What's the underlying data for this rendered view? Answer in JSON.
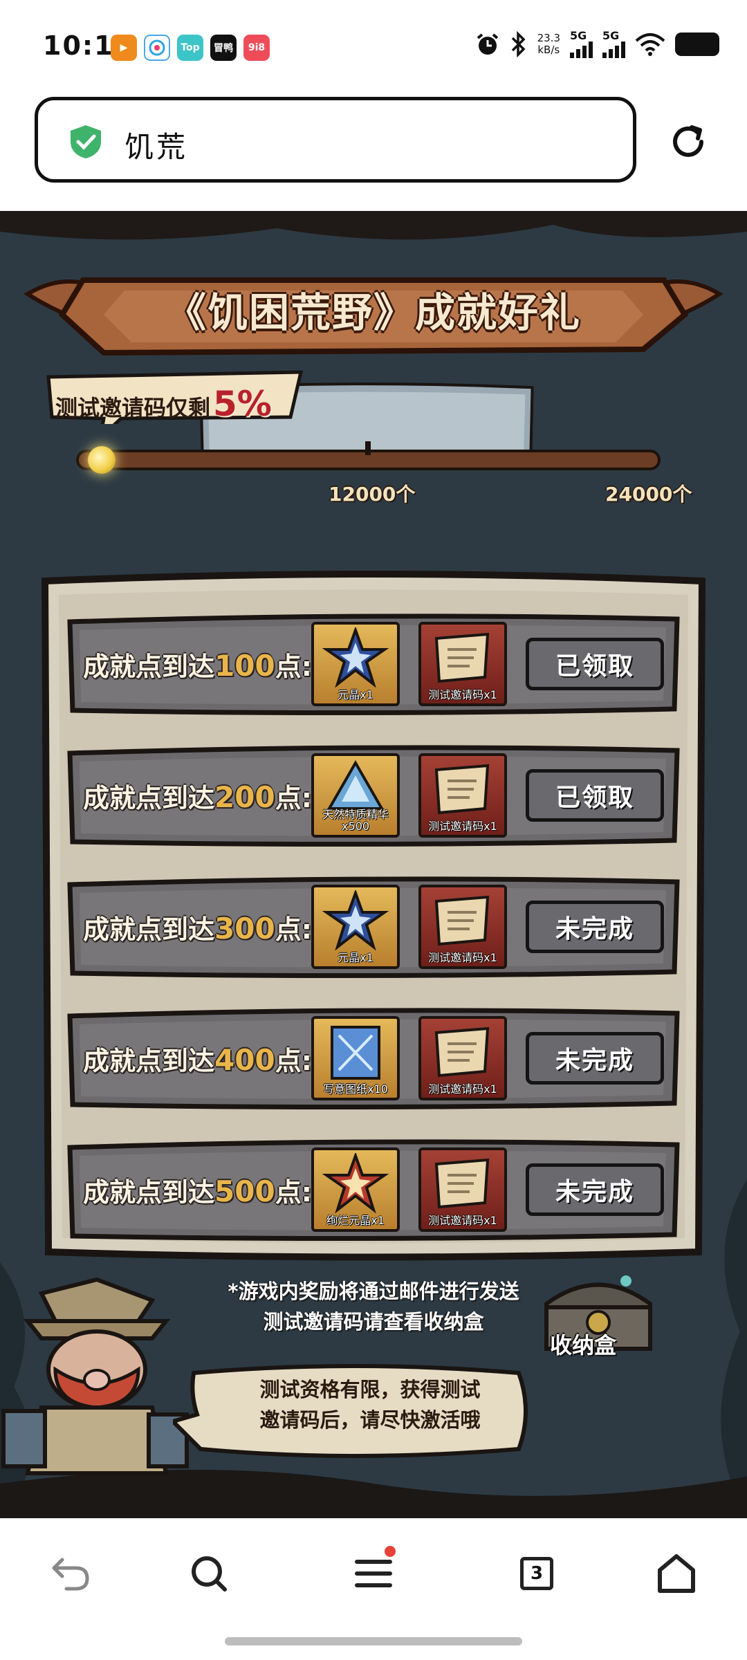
{
  "status_bar": {
    "time": "10:18",
    "net_speed": "23.3",
    "net_unit": "kB/s",
    "sig1": "5G",
    "sig2": "5G",
    "notif_apps": [
      "PPTV",
      "",
      "Top",
      "冒鸭",
      "9i8"
    ]
  },
  "url_bar": {
    "text": "饥荒"
  },
  "game": {
    "banner_title": "《饥困荒野》成就好礼",
    "invite_label": "测试邀请码仅剩",
    "invite_percent": "5%",
    "progress": {
      "fraction": 0.02,
      "milestones": [
        "12000个",
        "24000个"
      ]
    },
    "rows": [
      {
        "label_prefix": "成就点到达",
        "points": "100",
        "label_suffix": "点:",
        "reward1": "元晶x1",
        "reward1_icon": "star-crystal",
        "reward2": "测试邀请码x1",
        "status": "已领取"
      },
      {
        "label_prefix": "成就点到达",
        "points": "200",
        "label_suffix": "点:",
        "reward1": "天然特质精华x500",
        "reward1_icon": "blue-gem",
        "reward2": "测试邀请码x1",
        "status": "已领取"
      },
      {
        "label_prefix": "成就点到达",
        "points": "300",
        "label_suffix": "点:",
        "reward1": "元晶x1",
        "reward1_icon": "star-crystal",
        "reward2": "测试邀请码x1",
        "status": "未完成"
      },
      {
        "label_prefix": "成就点到达",
        "points": "400",
        "label_suffix": "点:",
        "reward1": "写意图纸x10",
        "reward1_icon": "blueprint",
        "reward2": "测试邀请码x1",
        "status": "未完成"
      },
      {
        "label_prefix": "成就点到达",
        "points": "500",
        "label_suffix": "点:",
        "reward1": "绚烂元晶x1",
        "reward1_icon": "red-star-crystal",
        "reward2": "测试邀请码x1",
        "status": "未完成"
      }
    ],
    "note_line1": "*游戏内奖励将通过邮件进行发送",
    "note_line2": "测试邀请码请查看收纳盒",
    "chest_label": "收纳盒",
    "bubble_line1": "测试资格有限，获得测试",
    "bubble_line2": "邀请码后，请尽快激活哦"
  },
  "bottom_nav": {
    "tab_count": "3"
  },
  "colors": {
    "accent_red": "#b8222a",
    "gold": "#e9b54a",
    "page_bg": "#2d3a44"
  }
}
